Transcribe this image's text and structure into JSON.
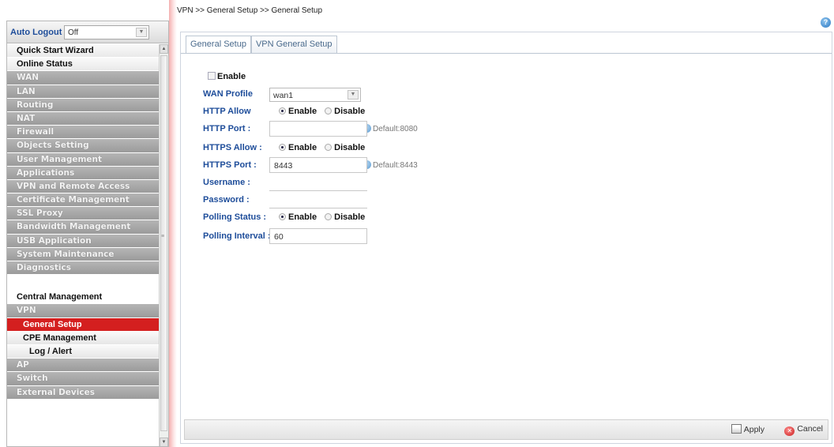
{
  "auto_logout": {
    "label": "Auto Logout :",
    "value": "Off"
  },
  "menu": {
    "quick_start": "Quick Start Wizard",
    "online_status": "Online Status",
    "wan": "WAN",
    "lan": "LAN",
    "routing": "Routing",
    "nat": "NAT",
    "firewall": "Firewall",
    "objects": "Objects Setting",
    "user_mgmt": "User Management",
    "applications": "Applications",
    "vpn_remote": "VPN and Remote Access",
    "certificate": "Certificate Management",
    "ssl_proxy": "SSL Proxy",
    "bandwidth": "Bandwidth Management",
    "usb": "USB Application",
    "system": "System Maintenance",
    "diagnostics": "Diagnostics",
    "central": "Central Management",
    "vpn": "VPN",
    "general_setup": "General Setup",
    "cpe": "CPE Management",
    "log_alert": "Log / Alert",
    "ap": "AP",
    "switch": "Switch",
    "external": "External Devices"
  },
  "breadcrumb": "VPN >> General Setup >> General Setup",
  "tabs": {
    "general": "General Setup",
    "vpn_general": "VPN General Setup"
  },
  "form": {
    "enable_label": "Enable",
    "wan_profile_label": "WAN Profile",
    "wan_profile_value": "wan1",
    "http_allow_label": "HTTP Allow",
    "http_port_label": "HTTP Port :",
    "http_port_value": "",
    "http_port_hint": "Default:8080",
    "https_allow_label": "HTTPS Allow :",
    "https_port_label": "HTTPS Port :",
    "https_port_value": "8443",
    "https_port_hint": "Default:8443",
    "username_label": "Username :",
    "password_label": "Password :",
    "polling_status_label": "Polling Status :",
    "polling_interval_label": "Polling Interval :",
    "polling_interval_value": "60",
    "enable_opt": "Enable",
    "disable_opt": "Disable"
  },
  "buttons": {
    "apply": "Apply",
    "cancel": "Cancel"
  },
  "icons": {
    "help": "help-icon",
    "info": "info-icon",
    "apply": "apply-icon",
    "cancel": "cancel-icon"
  },
  "colors": {
    "active_menu": "#d41f1f",
    "label_blue": "#1e4d9a",
    "menu_gray": "#a8a8a8"
  }
}
